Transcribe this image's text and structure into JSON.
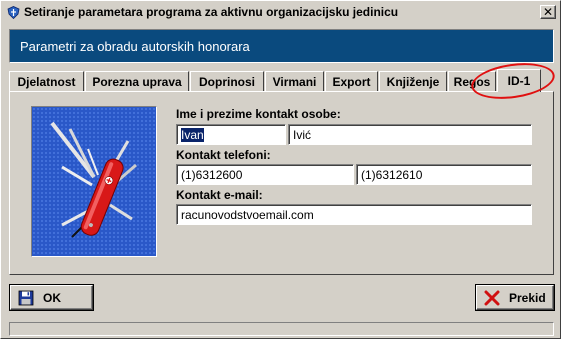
{
  "window": {
    "title": "Setiranje parametara programa za aktivnu organizacijsku jedinicu",
    "close_label": "✕"
  },
  "header": {
    "title": "Parametri za obradu autorskih honorara"
  },
  "tabs": [
    {
      "label": "Djelatnost",
      "underline": "",
      "active": false
    },
    {
      "label": "Porezna uprava",
      "underline": "",
      "active": false
    },
    {
      "label": "Doprinosi",
      "underline": "",
      "active": false
    },
    {
      "label": "Virmani",
      "underline": "",
      "active": false
    },
    {
      "label": "Export",
      "underline": "",
      "active": false
    },
    {
      "label": "Knjiženje",
      "underline": "",
      "active": false
    },
    {
      "label": "Regos",
      "underline": "",
      "active": false
    },
    {
      "label": "ID-1",
      "underline": "",
      "active": true
    }
  ],
  "form": {
    "contact_name_label": "Ime i prezime kontakt osobe:",
    "first_name": "Ivan",
    "last_name": "Ivić",
    "phones_label": "Kontakt telefoni:",
    "phone1": "(1)6312600",
    "phone2": "(1)6312610",
    "email_label": "Kontakt e-mail:",
    "email": "racunovodstvoemail.com"
  },
  "buttons": {
    "ok_label": "OK",
    "cancel_label": "Prekid"
  },
  "icons": {
    "app": "shield-icon",
    "picture": "swiss-army-knife-icon",
    "ok": "floppy-disk-icon",
    "cancel": "red-x-icon"
  },
  "colors": {
    "header_bg": "#0a4a7e",
    "selection": "#0a246a",
    "annotation": "#e01010",
    "picture_bg": "#2a58c8"
  }
}
